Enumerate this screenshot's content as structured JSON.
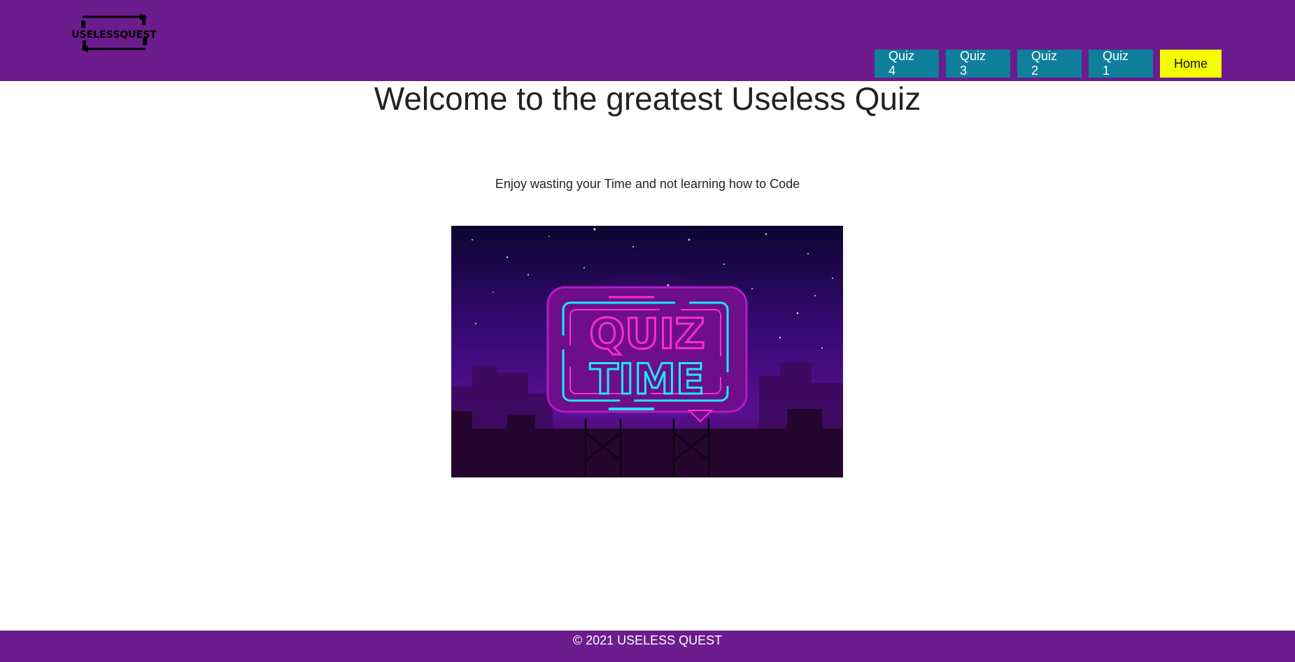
{
  "brand": {
    "logo_text": "USELESSQUEST"
  },
  "nav": {
    "items": [
      "Quiz 4",
      "Quiz 3",
      "Quiz 2",
      "Quiz 1",
      "Home"
    ],
    "active": "Home"
  },
  "main": {
    "title": "Welcome to the greatest Useless Quiz",
    "subtitle": "Enjoy wasting your Time and not learning how to Code",
    "hero_image_text": [
      "QUIZ",
      "TIME"
    ]
  },
  "footer": {
    "copyright": "© 2021 USELESS QUEST"
  },
  "colors": {
    "header_bg": "#6c1c8c",
    "nav_button": "#0f7f9c",
    "active_button": "#f5fc00",
    "footer_bg": "#6c1c8c"
  }
}
